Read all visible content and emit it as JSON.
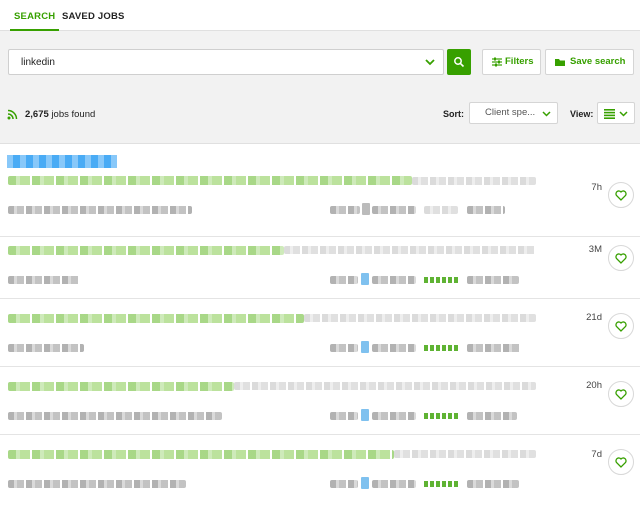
{
  "tabs": [
    {
      "label": "SEARCH",
      "active": true
    },
    {
      "label": "SAVED JOBS",
      "active": false
    }
  ],
  "search": {
    "value": "linkedin",
    "placeholder": ""
  },
  "buttons": {
    "filters": "Filters",
    "save_search": "Save search"
  },
  "results": {
    "count": "2,675",
    "suffix": "jobs found"
  },
  "sort": {
    "label": "Sort:",
    "selected": "Client spe..."
  },
  "view": {
    "label": "View:"
  },
  "jobs": [
    {
      "age": "7h"
    },
    {
      "age": "3M"
    },
    {
      "age": "21d"
    },
    {
      "age": "20h"
    },
    {
      "age": "7d"
    }
  ],
  "colors": {
    "accent": "#37a000",
    "background": "#f2f2f2",
    "border": "#e0e0e0"
  },
  "icons": {
    "search_button": "search-icon",
    "dropdown": "chevron-down-icon",
    "filters": "sliders-icon",
    "save_search": "folder-icon",
    "rss": "rss-icon",
    "view": "list-icon",
    "favorite": "heart-icon"
  }
}
